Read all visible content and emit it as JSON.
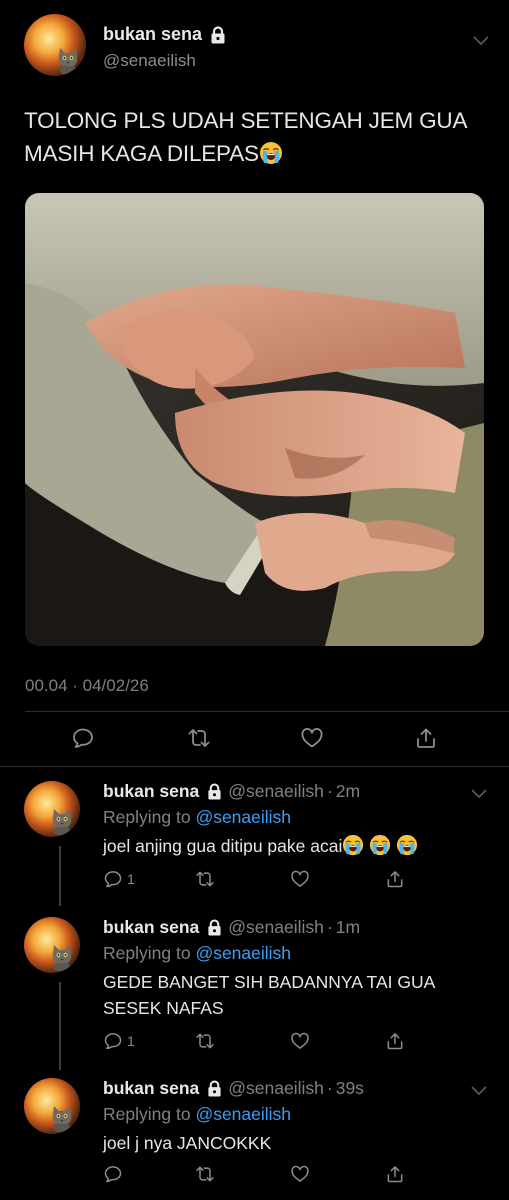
{
  "main": {
    "display_name": "bukan sena",
    "handle": "@senaeilish",
    "text": "TOLONG PLS UDAH SETENGAH JEM GUA MASIH KAGA DILEPAS",
    "timestamp": "00.04 · 04/02/26"
  },
  "replies": [
    {
      "display_name": "bukan sena",
      "handle": "@senaeilish",
      "time": "2m",
      "replying_prefix": "Replying to",
      "replying_to": "@senaeilish",
      "text": "joel anjing gua ditipu pake acai",
      "emoji_count": 3,
      "reply_count": "1"
    },
    {
      "display_name": "bukan sena",
      "handle": "@senaeilish",
      "time": "1m",
      "replying_prefix": "Replying to",
      "replying_to": "@senaeilish",
      "text": "GEDE BANGET SIH BADANNYA TAI GUA SESEK NAFAS",
      "reply_count": "1"
    },
    {
      "display_name": "bukan sena",
      "handle": "@senaeilish",
      "time": "39s",
      "replying_prefix": "Replying to",
      "replying_to": "@senaeilish",
      "text": "joel j nya JANCOKKK",
      "reply_count": ""
    }
  ],
  "colors": {
    "background": "#000000",
    "link": "#3d9df2",
    "secondary_text": "#7e8287"
  },
  "icons": [
    "lock-icon",
    "chevron-down-icon",
    "reply-icon",
    "retweet-icon",
    "like-icon",
    "share-icon",
    "loudly-crying-face-emoji"
  ]
}
